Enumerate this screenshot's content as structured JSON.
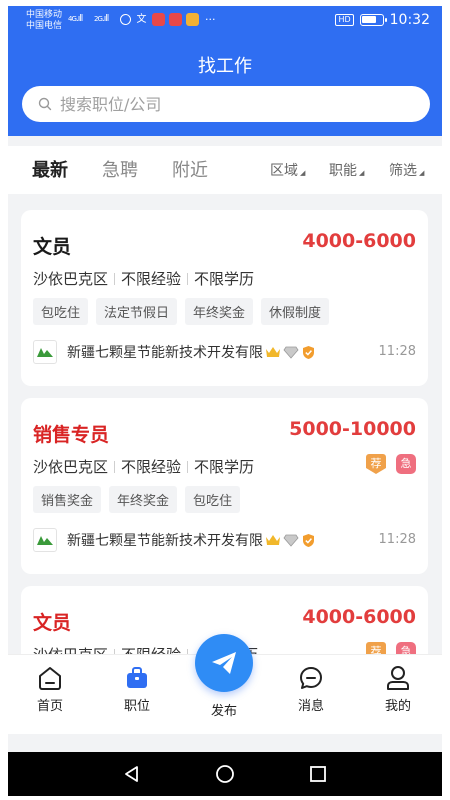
{
  "status_bar": {
    "carrier_1": "中国移动",
    "carrier_2": "中国电信",
    "network_1": "4G",
    "network_2": "2G",
    "more": "···",
    "hd": "HD",
    "time": "10:32",
    "battery_level": 0.75
  },
  "header": {
    "title": "找工作",
    "search_placeholder": "搜索职位/公司"
  },
  "tabs": [
    {
      "label": "最新",
      "active": true
    },
    {
      "label": "急聘",
      "active": false
    },
    {
      "label": "附近",
      "active": false
    }
  ],
  "filters": [
    {
      "label": "区域"
    },
    {
      "label": "职能"
    },
    {
      "label": "筛选"
    }
  ],
  "jobs": [
    {
      "title": "文员",
      "salary": "4000-6000",
      "district": "沙依巴克区",
      "experience": "不限经验",
      "education": "不限学历",
      "tags": [
        "包吃住",
        "法定节假日",
        "年终奖金",
        "休假制度"
      ],
      "company": "新疆七颗星节能新技术开发有限",
      "time": "11:28"
    },
    {
      "title": "销售专员",
      "salary": "5000-10000",
      "district": "沙依巴克区",
      "experience": "不限经验",
      "education": "不限学历",
      "badge_recommend": "荐",
      "badge_urgent": "急",
      "tags": [
        "销售奖金",
        "年终奖金",
        "包吃住"
      ],
      "company": "新疆七颗星节能新技术开发有限",
      "time": "11:28"
    },
    {
      "title": "文员",
      "salary": "4000-6000",
      "district": "沙依巴克区",
      "experience": "不限经验",
      "education": "学历",
      "badge_recommend": "荐",
      "badge_urgent": "急"
    }
  ],
  "bottom_nav": [
    {
      "label": "首页"
    },
    {
      "label": "职位"
    },
    {
      "label": "发布"
    },
    {
      "label": "消息"
    },
    {
      "label": "我的"
    }
  ],
  "colors": {
    "primary": "#2f6ef2",
    "salary": "#e23d3d",
    "urgent_title": "#d92424",
    "badge_recommend": "#f0a14a",
    "badge_urgent": "#ef6f7f"
  }
}
